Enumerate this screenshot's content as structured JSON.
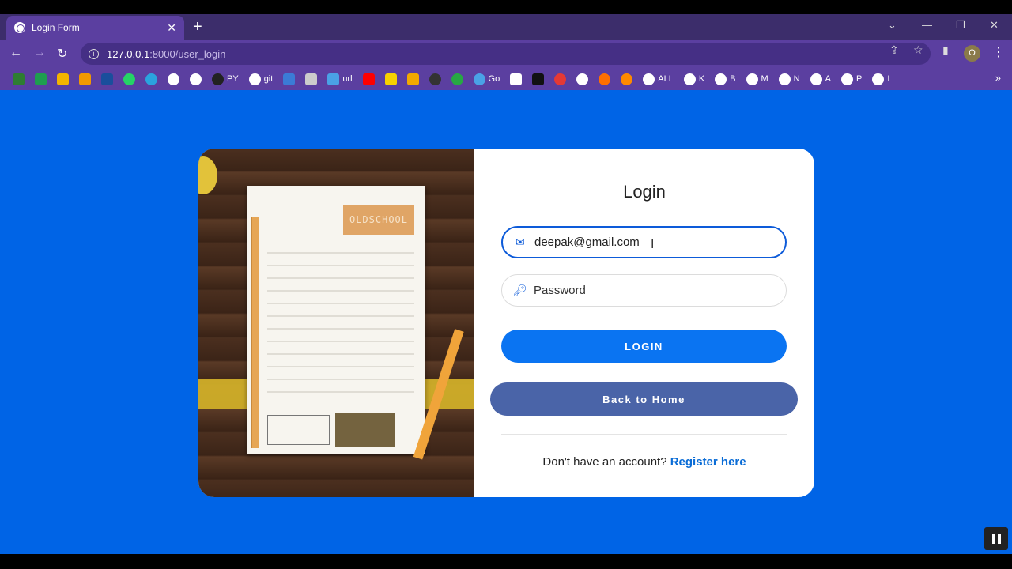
{
  "browser": {
    "tab": {
      "title": "Login Form",
      "close": "✕"
    },
    "new_tab": "+",
    "window_controls": {
      "list": "⌄",
      "minimize": "—",
      "restore": "❐",
      "close": "✕"
    },
    "nav": {
      "back": "←",
      "forward": "→",
      "reload": "↻"
    },
    "url": {
      "host": "127.0.0.1",
      "path": ":8000/user_login"
    },
    "profile_initial": "O",
    "bookmarks": [
      {
        "label": "",
        "color": "#2e7d32",
        "shape": "sq"
      },
      {
        "label": "",
        "color": "#1e9e4f",
        "shape": "sq"
      },
      {
        "label": "",
        "color": "#f4b400",
        "shape": "sq"
      },
      {
        "label": "",
        "color": "#f29900",
        "shape": "sq"
      },
      {
        "label": "",
        "color": "#1a4e9c",
        "shape": "sq"
      },
      {
        "label": "",
        "color": "#25d366",
        "shape": "round"
      },
      {
        "label": "",
        "color": "#2aa3de",
        "shape": "round"
      },
      {
        "label": "",
        "color": "#ffffff",
        "shape": "round"
      },
      {
        "label": "",
        "color": "#ffffff",
        "shape": "round"
      },
      {
        "label": "PY",
        "color": "#222222",
        "shape": "round"
      },
      {
        "label": "git",
        "color": "#ffffff",
        "shape": "round"
      },
      {
        "label": "",
        "color": "#3b7bd6",
        "shape": "sq"
      },
      {
        "label": "",
        "color": "#cccccc",
        "shape": "sq"
      },
      {
        "label": "url",
        "color": "#4aa1e6",
        "shape": "sq"
      },
      {
        "label": "",
        "color": "#ff0000",
        "shape": "sq"
      },
      {
        "label": "",
        "color": "#f7d100",
        "shape": "sq"
      },
      {
        "label": "",
        "color": "#f2a900",
        "shape": "sq"
      },
      {
        "label": "",
        "color": "#333333",
        "shape": "round"
      },
      {
        "label": "",
        "color": "#27a844",
        "shape": "round"
      },
      {
        "label": "Go",
        "color": "#4aa1e6",
        "shape": "round"
      },
      {
        "label": "",
        "color": "#ffffff",
        "shape": "sq"
      },
      {
        "label": "",
        "color": "#111111",
        "shape": "sq"
      },
      {
        "label": "",
        "color": "#e53935",
        "shape": "round"
      },
      {
        "label": "",
        "color": "#ffffff",
        "shape": "round"
      },
      {
        "label": "",
        "color": "#ff6f00",
        "shape": "round"
      },
      {
        "label": "",
        "color": "#ff8a00",
        "shape": "round"
      },
      {
        "label": "ALL",
        "color": "#ffffff",
        "shape": "round"
      },
      {
        "label": "K",
        "color": "#ffffff",
        "shape": "round"
      },
      {
        "label": "B",
        "color": "#ffffff",
        "shape": "round"
      },
      {
        "label": "M",
        "color": "#ffffff",
        "shape": "round"
      },
      {
        "label": "N",
        "color": "#ffffff",
        "shape": "round"
      },
      {
        "label": "A",
        "color": "#ffffff",
        "shape": "round"
      },
      {
        "label": "P",
        "color": "#ffffff",
        "shape": "round"
      },
      {
        "label": "I",
        "color": "#ffffff",
        "shape": "round"
      }
    ],
    "bookmarks_overflow": "»"
  },
  "login": {
    "title": "Login",
    "email_value": "deepak@gmail.com",
    "password_placeholder": "Password",
    "login_button": "LOGIN",
    "home_button": "Back to Home",
    "no_account_text": "Don't have an account? ",
    "register_link": "Register here"
  },
  "hero": {
    "stamp_text": "OLDSCHOOL"
  },
  "icons": {
    "email": "envelope-icon",
    "password": "key-icon"
  },
  "colors": {
    "page_bg": "#0064e6",
    "login_button": "#0a74f2",
    "home_button": "#4a64a8",
    "link": "#0a6cd6"
  }
}
